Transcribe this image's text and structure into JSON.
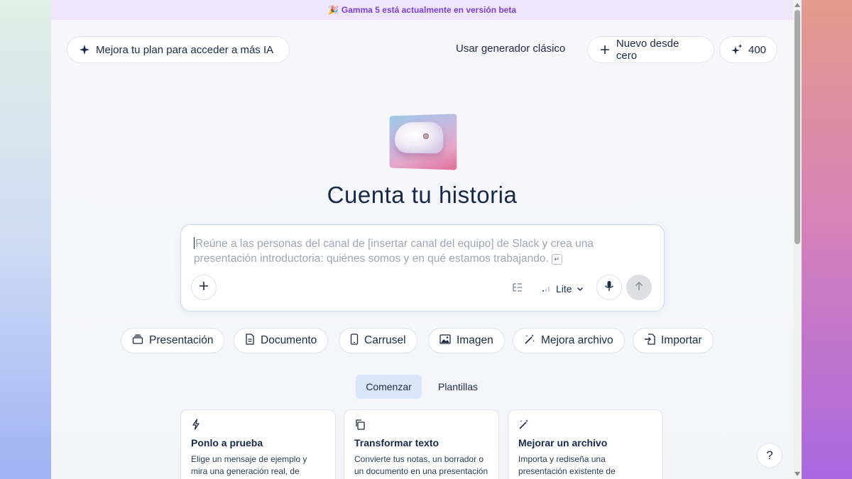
{
  "banner": {
    "emoji": "🎉",
    "text": "Gamma 5 está actualmente en versión beta"
  },
  "header": {
    "upgrade_label": "Mejora tu plan para acceder a más IA",
    "classic_label": "Usar generador clásico",
    "new_label": "Nuevo desde cero",
    "credits": "400"
  },
  "hero": {
    "title": "Cuenta tu historia"
  },
  "prompt": {
    "placeholder": "Reúne a las personas del canal de [insertar canal del equipo] de Slack y crea una presentación introductoria: quiénes somos y en qué estamos trabajando.",
    "enter_symbol": "↵",
    "model": "Lite"
  },
  "types": [
    {
      "label": "Presentación",
      "icon": "slides-icon"
    },
    {
      "label": "Documento",
      "icon": "document-icon"
    },
    {
      "label": "Carrusel",
      "icon": "phone-icon"
    },
    {
      "label": "Imagen",
      "icon": "image-icon"
    },
    {
      "label": "Mejora archivo",
      "icon": "magic-wand-icon"
    },
    {
      "label": "Importar",
      "icon": "import-icon"
    }
  ],
  "tabs": [
    {
      "label": "Comenzar",
      "active": true
    },
    {
      "label": "Plantillas",
      "active": false
    }
  ],
  "cards": [
    {
      "title": "Ponlo a prueba",
      "desc": "Elige un mensaje de ejemplo y mira una generación real, de principio a",
      "icon": "bolt-icon"
    },
    {
      "title": "Transformar texto",
      "desc": "Convierte tus notas, un borrador o un documento en una presentación",
      "icon": "copy-icon"
    },
    {
      "title": "Mejorar un archivo",
      "desc": "Importa y rediseña una presentación existente de",
      "icon": "magic-wand-icon"
    }
  ],
  "help": "?",
  "colors": {
    "accent": "#7a3fd6",
    "text": "#1d2a44",
    "active_tab": "#d9e6fb"
  }
}
